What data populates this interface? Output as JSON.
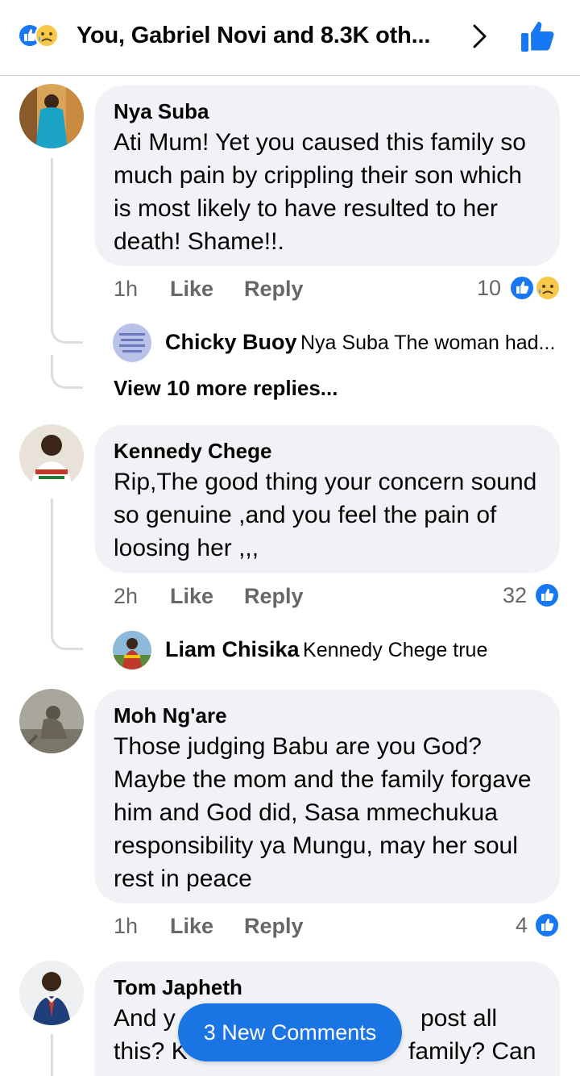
{
  "header": {
    "title": "You, Gabriel Novi and 8.3K oth...",
    "react_icons": [
      "like-icon",
      "sad-icon"
    ]
  },
  "comments": [
    {
      "name": "Nya Suba",
      "text": "Ati Mum! Yet you caused this family so much pain by crippling their son which is most likely to have resulted to her death! Shame!!.",
      "time": "1h",
      "like_label": "Like",
      "reply_label": "Reply",
      "reaction_count": "10",
      "reactions": [
        "like-icon",
        "sad-icon"
      ],
      "reply_preview": {
        "name": "Chicky Buoy",
        "text": "Nya Suba The woman had..."
      },
      "view_more": "View 10 more replies..."
    },
    {
      "name": "Kennedy Chege",
      "text": "Rip,The good thing your concern sound so genuine ,and you feel the pain of loosing her ,,,",
      "time": "2h",
      "like_label": "Like",
      "reply_label": "Reply",
      "reaction_count": "32",
      "reactions": [
        "like-icon"
      ],
      "reply_preview": {
        "name": "Liam Chisika",
        "text": "Kennedy Chege true"
      }
    },
    {
      "name": "Moh Ng'are",
      "text": "Those judging Babu are you God? Maybe the mom and the family forgave him and God did, Sasa mmechukua responsibility ya Mungu, may her soul rest in peace",
      "time": "1h",
      "like_label": "Like",
      "reply_label": "Reply",
      "reaction_count": "4",
      "reactions": [
        "like-icon"
      ]
    },
    {
      "name": "Tom Japheth",
      "text_visible_left": "And y",
      "text_visible_right": "post all",
      "text_line2_left": "this? K",
      "text_line2_right": "family? Can"
    }
  ],
  "new_comments_label": "3 New Comments",
  "colors": {
    "accent": "#1b74e4",
    "bubble": "#f0f2f5",
    "secondary_text": "#65676b"
  }
}
